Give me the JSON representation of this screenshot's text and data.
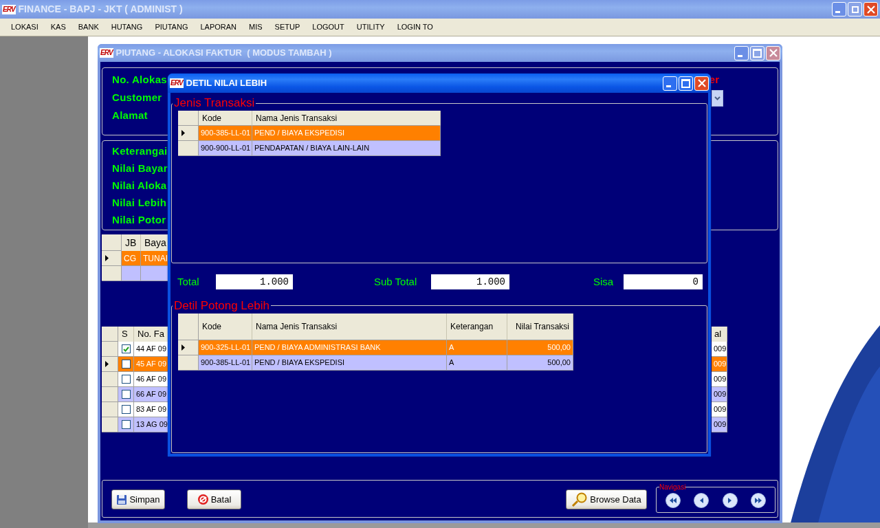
{
  "app_window": {
    "logo": "ERV",
    "title": "FINANCE - BAPJ - JKT ( ADMINIST )",
    "controls": [
      {
        "kind": "minimize",
        "disabled": false
      },
      {
        "kind": "restore",
        "disabled": true
      },
      {
        "kind": "close",
        "disabled": false
      }
    ]
  },
  "menu": [
    "LOKASI",
    "KAS",
    "BANK",
    "HUTANG",
    "PIUTANG",
    "LAPORAN",
    "MIS",
    "SETUP",
    "LOGOUT",
    "UTILITY",
    "LOGIN TO"
  ],
  "form_window": {
    "logo": "ERV",
    "title": "PIUTANG - ALOKASI FAKTUR  ( MODUS TAMBAH )",
    "controls": [
      {
        "kind": "minimize",
        "disabled": false
      },
      {
        "kind": "maximize",
        "disabled": true
      },
      {
        "kind": "close",
        "disabled": true
      }
    ],
    "header_labels": [
      "No. Alokas",
      "Customer",
      "Alamat"
    ],
    "header_right_label": "er",
    "detail_labels": [
      "Keterangai",
      "Nilai Bayar",
      "Nilai Aloka",
      "Nilai Lebih",
      "Nilai Potor"
    ],
    "payment_grid": {
      "columns": [
        "JB",
        "Baya"
      ],
      "rows": [
        {
          "selected": true,
          "cells": [
            "CG",
            "TUNAI"
          ]
        },
        {
          "selected": false
        }
      ]
    },
    "invoice_grid": {
      "columns": [
        "S",
        "No. Fa"
      ],
      "right_column": "al",
      "rows": [
        {
          "checked": true,
          "selected": false,
          "number": "44 AF 09",
          "tail": "009"
        },
        {
          "checked": false,
          "selected": true,
          "number": "45 AF 09",
          "tail": "009"
        },
        {
          "checked": false,
          "selected": false,
          "number": "46 AF 09",
          "tail": "009"
        },
        {
          "checked": false,
          "selected": false,
          "number": "66 AF 09",
          "tail": "009"
        },
        {
          "checked": false,
          "selected": false,
          "number": "83 AF 09",
          "tail": "009"
        },
        {
          "checked": false,
          "selected": false,
          "number": "13 AG 09",
          "tail": "009"
        }
      ]
    },
    "buttons": [
      {
        "kind": "save",
        "label": "Simpan"
      },
      {
        "kind": "cancel",
        "label": "Batal"
      },
      {
        "kind": "browse",
        "label": "Browse Data"
      }
    ],
    "navigation": {
      "title": "Navigasi",
      "buttons": [
        {
          "kind": "first"
        },
        {
          "kind": "previous"
        },
        {
          "kind": "next"
        },
        {
          "kind": "last"
        }
      ]
    }
  },
  "dialog": {
    "logo": "ERV",
    "title": "DETIL NILAI LEBIH",
    "controls": [
      {
        "kind": "minimize",
        "disabled": false
      },
      {
        "kind": "maximize",
        "disabled": false
      },
      {
        "kind": "close",
        "disabled": false
      }
    ],
    "jenis_transaksi": {
      "title": "Jenis Transaksi",
      "columns": [
        "Kode",
        "Nama Jenis Transaksi"
      ],
      "rows": [
        {
          "selected": true,
          "cells": [
            "900-385-LL-01",
            "PEND / BIAYA EKSPEDISI"
          ]
        },
        {
          "selected": false,
          "cells": [
            "900-900-LL-01",
            "PENDAPATAN / BIAYA LAIN-LAIN"
          ]
        }
      ]
    },
    "totals": [
      {
        "label": "Total",
        "value": "1.000"
      },
      {
        "label": "Sub Total",
        "value": "1.000"
      },
      {
        "label": "Sisa",
        "value": "0"
      }
    ],
    "detil_potong_lebih": {
      "title": "Detil Potong Lebih",
      "columns": [
        "Kode",
        "Nama Jenis Transaksi",
        "Keterangan",
        "Nilai Transaksi"
      ],
      "rows": [
        {
          "selected": true,
          "cells": [
            "900-325-LL-01",
            "PEND / BIAYA ADMINISTRASI BANK",
            "A",
            "500,00"
          ]
        },
        {
          "selected": false,
          "cells": [
            "900-385-LL-01",
            "PEND / BIAYA EKSPEDISI",
            "A",
            "500,00"
          ]
        }
      ]
    }
  }
}
